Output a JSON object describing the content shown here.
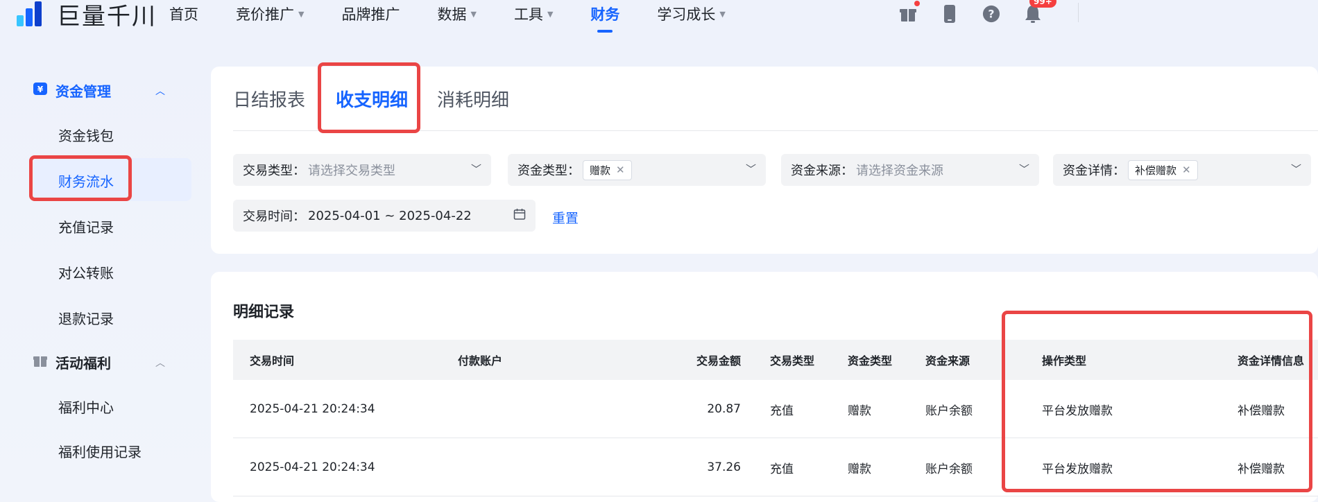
{
  "brand": {
    "name": "巨量千川"
  },
  "nav": {
    "items": [
      {
        "label": "首页",
        "caret": false,
        "active": false
      },
      {
        "label": "竞价推广",
        "caret": true,
        "active": false
      },
      {
        "label": "品牌推广",
        "caret": false,
        "active": false
      },
      {
        "label": "数据",
        "caret": true,
        "active": false
      },
      {
        "label": "工具",
        "caret": true,
        "active": false
      },
      {
        "label": "财务",
        "caret": false,
        "active": true
      },
      {
        "label": "学习成长",
        "caret": true,
        "active": false
      }
    ],
    "notification_badge": "99+"
  },
  "sidebar": {
    "group1": {
      "label": "资金管理",
      "icon": "yen-icon"
    },
    "items1": [
      "资金钱包",
      "财务流水",
      "充值记录",
      "对公转账",
      "退款记录"
    ],
    "active_item": "财务流水",
    "group2": {
      "label": "活动福利",
      "icon": "gift-icon"
    },
    "items2": [
      "福利中心",
      "福利使用记录"
    ]
  },
  "tabs": [
    "日结报表",
    "收支明细",
    "消耗明细"
  ],
  "active_tab": "收支明细",
  "filters": {
    "trade_type": {
      "label": "交易类型：",
      "placeholder": "请选择交易类型"
    },
    "fund_type": {
      "label": "资金类型：",
      "tag": "赠款"
    },
    "fund_source": {
      "label": "资金来源：",
      "placeholder": "请选择资金来源"
    },
    "fund_detail": {
      "label": "资金详情：",
      "tag": "补偿赠款"
    },
    "trade_time": {
      "label": "交易时间：",
      "value": "2025-04-01 ~ 2025-04-22"
    },
    "reset_label": "重置"
  },
  "details": {
    "title": "明细记录",
    "columns": [
      "交易时间",
      "付款账户",
      "交易金额",
      "交易类型",
      "资金类型",
      "资金来源",
      "操作类型",
      "资金详情信息"
    ],
    "rows": [
      {
        "time": "2025-04-21 20:24:34",
        "account": "",
        "amount": "20.87",
        "trade_type": "充值",
        "fund_type": "赠款",
        "fund_source": "账户余额",
        "op_type": "平台发放赠款",
        "fund_detail": "补偿赠款"
      },
      {
        "time": "2025-04-21 20:24:34",
        "account": "",
        "amount": "37.26",
        "trade_type": "充值",
        "fund_type": "赠款",
        "fund_source": "账户余额",
        "op_type": "平台发放赠款",
        "fund_detail": "补偿赠款"
      }
    ]
  },
  "colors": {
    "accent": "#1664ff",
    "highlight": "#ea4545"
  }
}
